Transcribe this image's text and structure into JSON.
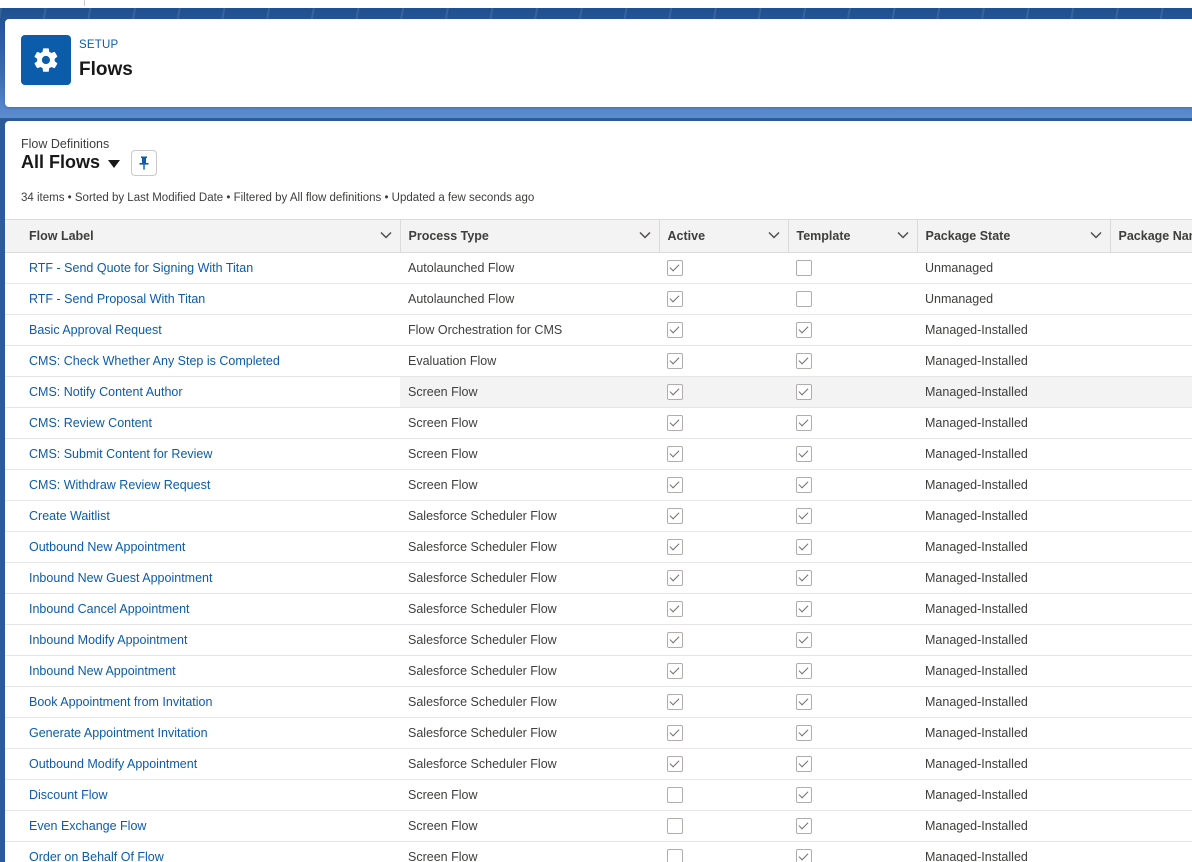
{
  "header": {
    "breadcrumb": "SETUP",
    "title": "Flows",
    "icon": "gear-icon"
  },
  "list_view": {
    "object_label": "Flow Definitions",
    "view_name": "All Flows",
    "info": "34 items • Sorted by Last Modified Date • Filtered by All flow definitions • Updated a few seconds ago",
    "pin_icon": "pin-icon"
  },
  "table": {
    "columns": [
      "Flow Label",
      "Process Type",
      "Active",
      "Template",
      "Package State",
      "Package Name"
    ],
    "rows": [
      {
        "label": "RTF - Send Quote for Signing With Titan",
        "type": "Autolaunched Flow",
        "active": true,
        "template": false,
        "state": "Unmanaged"
      },
      {
        "label": "RTF - Send Proposal With Titan",
        "type": "Autolaunched Flow",
        "active": true,
        "template": false,
        "state": "Unmanaged"
      },
      {
        "label": "Basic Approval Request",
        "type": "Flow Orchestration for CMS",
        "active": true,
        "template": true,
        "state": "Managed-Installed"
      },
      {
        "label": "CMS: Check Whether Any Step is Completed",
        "type": "Evaluation Flow",
        "active": true,
        "template": true,
        "state": "Managed-Installed"
      },
      {
        "label": "CMS: Notify Content Author",
        "type": "Screen Flow",
        "active": true,
        "template": true,
        "state": "Managed-Installed"
      },
      {
        "label": "CMS: Review Content",
        "type": "Screen Flow",
        "active": true,
        "template": true,
        "state": "Managed-Installed"
      },
      {
        "label": "CMS: Submit Content for Review",
        "type": "Screen Flow",
        "active": true,
        "template": true,
        "state": "Managed-Installed"
      },
      {
        "label": "CMS: Withdraw Review Request",
        "type": "Screen Flow",
        "active": true,
        "template": true,
        "state": "Managed-Installed"
      },
      {
        "label": "Create Waitlist",
        "type": "Salesforce Scheduler Flow",
        "active": true,
        "template": true,
        "state": "Managed-Installed"
      },
      {
        "label": "Outbound New Appointment",
        "type": "Salesforce Scheduler Flow",
        "active": true,
        "template": true,
        "state": "Managed-Installed"
      },
      {
        "label": "Inbound New Guest Appointment",
        "type": "Salesforce Scheduler Flow",
        "active": true,
        "template": true,
        "state": "Managed-Installed"
      },
      {
        "label": "Inbound Cancel Appointment",
        "type": "Salesforce Scheduler Flow",
        "active": true,
        "template": true,
        "state": "Managed-Installed"
      },
      {
        "label": "Inbound Modify Appointment",
        "type": "Salesforce Scheduler Flow",
        "active": true,
        "template": true,
        "state": "Managed-Installed"
      },
      {
        "label": "Inbound New Appointment",
        "type": "Salesforce Scheduler Flow",
        "active": true,
        "template": true,
        "state": "Managed-Installed"
      },
      {
        "label": "Book Appointment from Invitation",
        "type": "Salesforce Scheduler Flow",
        "active": true,
        "template": true,
        "state": "Managed-Installed"
      },
      {
        "label": "Generate Appointment Invitation",
        "type": "Salesforce Scheduler Flow",
        "active": true,
        "template": true,
        "state": "Managed-Installed"
      },
      {
        "label": "Outbound Modify Appointment",
        "type": "Salesforce Scheduler Flow",
        "active": true,
        "template": true,
        "state": "Managed-Installed"
      },
      {
        "label": "Discount Flow",
        "type": "Screen Flow",
        "active": false,
        "template": true,
        "state": "Managed-Installed"
      },
      {
        "label": "Even Exchange Flow",
        "type": "Screen Flow",
        "active": false,
        "template": true,
        "state": "Managed-Installed"
      },
      {
        "label": "Order on Behalf Of Flow",
        "type": "Screen Flow",
        "active": false,
        "template": true,
        "state": "Managed-Installed"
      }
    ]
  },
  "colors": {
    "brand": "#0b5cab",
    "background": "#2d5b98"
  }
}
